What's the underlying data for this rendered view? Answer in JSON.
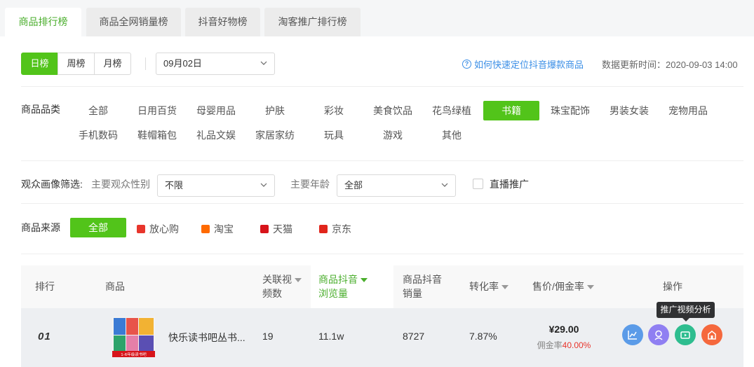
{
  "tabs": [
    {
      "label": "商品排行榜"
    },
    {
      "label": "商品全网销量榜"
    },
    {
      "label": "抖音好物榜"
    },
    {
      "label": "淘客推广排行榜"
    }
  ],
  "period": {
    "day": "日榜",
    "week": "周榜",
    "month": "月榜"
  },
  "date_select": {
    "value": "09月02日"
  },
  "help_link": "如何快速定位抖音爆款商品",
  "update_time": "数据更新时间：2020-09-03 14:00",
  "category": {
    "label": "商品品类",
    "items": [
      "全部",
      "日用百货",
      "母婴用品",
      "护肤",
      "彩妆",
      "美食饮品",
      "花鸟绿植",
      "书籍",
      "珠宝配饰",
      "男装女装",
      "宠物用品",
      "手机数码",
      "鞋帽箱包",
      "礼品文娱",
      "家居家纺",
      "玩具",
      "游戏",
      "其他"
    ],
    "active": "书籍"
  },
  "audience": {
    "label": "观众画像筛选:",
    "gender_label": "主要观众性别",
    "gender_value": "不限",
    "age_label": "主要年龄",
    "age_value": "全部",
    "live_label": "直播推广"
  },
  "source": {
    "label": "商品来源",
    "all": "全部",
    "items": [
      {
        "label": "放心购",
        "color": "#e8352c"
      },
      {
        "label": "淘宝",
        "color": "#ff6a00"
      },
      {
        "label": "天猫",
        "color": "#d7141a"
      },
      {
        "label": "京东",
        "color": "#e1251b"
      }
    ]
  },
  "table": {
    "headers": {
      "rank": "排行",
      "product": "商品",
      "videos_1": "关联视",
      "videos_2": "频数",
      "views_1": "商品抖音",
      "views_2": "浏览量",
      "sales_1": "商品抖音",
      "sales_2": "销量",
      "conversion": "转化率",
      "price": "售价/佣金率",
      "actions": "操作"
    },
    "rows": [
      {
        "rank": "01",
        "name": "快乐读书吧丛书...",
        "thumb_caption": "1-6年级读书吧",
        "videos": "19",
        "views": "11.1w",
        "sales": "8727",
        "conversion": "7.87%",
        "price": "¥29.00",
        "commission_label": "佣金率",
        "commission_rate": "40.00%"
      }
    ]
  },
  "actions": [
    {
      "icon": "trend-chart-icon",
      "color": "#5b9be8"
    },
    {
      "icon": "user-portrait-icon",
      "color": "#8f7ff2"
    },
    {
      "icon": "video-icon",
      "color": "#2ebd8f"
    },
    {
      "icon": "shop-icon",
      "color": "#f5683d"
    }
  ],
  "tooltip": "推广视频分析"
}
